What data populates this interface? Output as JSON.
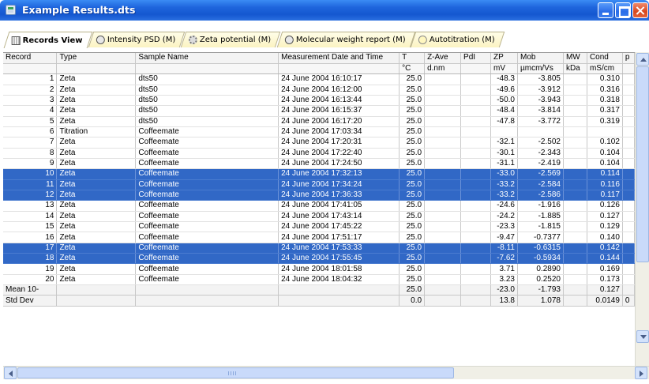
{
  "window": {
    "title": "Example Results.dts"
  },
  "tabs": [
    {
      "label": "Records View",
      "icon": "grid-icon",
      "active": true
    },
    {
      "label": "Intensity PSD (M)",
      "icon": "psd-icon",
      "active": false
    },
    {
      "label": "Zeta potential (M)",
      "icon": "zeta-icon",
      "active": false
    },
    {
      "label": "Molecular weight report (M)",
      "icon": "molecule-icon",
      "active": false
    },
    {
      "label": "Autotitration (M)",
      "icon": "titration-icon",
      "active": false
    }
  ],
  "table": {
    "columns": [
      "Record",
      "Type",
      "Sample Name",
      "Measurement Date and Time",
      "T",
      "Z-Ave",
      "PdI",
      "ZP",
      "Mob",
      "MW",
      "Cond",
      "p"
    ],
    "units": [
      "",
      "",
      "",
      "",
      "°C",
      "d.nm",
      "",
      "mV",
      "µmcm/Vs",
      "kDa",
      "mS/cm",
      ""
    ],
    "rows": [
      {
        "cells": [
          "1",
          "Zeta",
          "dts50",
          "24 June 2004 16:10:17",
          "25.0",
          "",
          "",
          "-48.3",
          "-3.805",
          "",
          "0.310",
          ""
        ],
        "selected": false
      },
      {
        "cells": [
          "2",
          "Zeta",
          "dts50",
          "24 June 2004 16:12:00",
          "25.0",
          "",
          "",
          "-49.6",
          "-3.912",
          "",
          "0.316",
          ""
        ],
        "selected": false
      },
      {
        "cells": [
          "3",
          "Zeta",
          "dts50",
          "24 June 2004 16:13:44",
          "25.0",
          "",
          "",
          "-50.0",
          "-3.943",
          "",
          "0.318",
          ""
        ],
        "selected": false
      },
      {
        "cells": [
          "4",
          "Zeta",
          "dts50",
          "24 June 2004 16:15:37",
          "25.0",
          "",
          "",
          "-48.4",
          "-3.814",
          "",
          "0.317",
          ""
        ],
        "selected": false
      },
      {
        "cells": [
          "5",
          "Zeta",
          "dts50",
          "24 June 2004 16:17:20",
          "25.0",
          "",
          "",
          "-47.8",
          "-3.772",
          "",
          "0.319",
          ""
        ],
        "selected": false
      },
      {
        "cells": [
          "6",
          "Titration",
          "Coffeemate",
          "24 June 2004 17:03:34",
          "25.0",
          "",
          "",
          "",
          "",
          "",
          "",
          ""
        ],
        "selected": false
      },
      {
        "cells": [
          "7",
          "Zeta",
          "Coffeemate",
          "24 June 2004 17:20:31",
          "25.0",
          "",
          "",
          "-32.1",
          "-2.502",
          "",
          "0.102",
          ""
        ],
        "selected": false
      },
      {
        "cells": [
          "8",
          "Zeta",
          "Coffeemate",
          "24 June 2004 17:22:40",
          "25.0",
          "",
          "",
          "-30.1",
          "-2.343",
          "",
          "0.104",
          ""
        ],
        "selected": false
      },
      {
        "cells": [
          "9",
          "Zeta",
          "Coffeemate",
          "24 June 2004 17:24:50",
          "25.0",
          "",
          "",
          "-31.1",
          "-2.419",
          "",
          "0.104",
          ""
        ],
        "selected": false
      },
      {
        "cells": [
          "10",
          "Zeta",
          "Coffeemate",
          "24 June 2004 17:32:13",
          "25.0",
          "",
          "",
          "-33.0",
          "-2.569",
          "",
          "0.114",
          ""
        ],
        "selected": true
      },
      {
        "cells": [
          "11",
          "Zeta",
          "Coffeemate",
          "24 June 2004 17:34:24",
          "25.0",
          "",
          "",
          "-33.2",
          "-2.584",
          "",
          "0.116",
          ""
        ],
        "selected": true
      },
      {
        "cells": [
          "12",
          "Zeta",
          "Coffeemate",
          "24 June 2004 17:36:33",
          "25.0",
          "",
          "",
          "-33.2",
          "-2.586",
          "",
          "0.117",
          ""
        ],
        "selected": true
      },
      {
        "cells": [
          "13",
          "Zeta",
          "Coffeemate",
          "24 June 2004 17:41:05",
          "25.0",
          "",
          "",
          "-24.6",
          "-1.916",
          "",
          "0.126",
          ""
        ],
        "selected": false
      },
      {
        "cells": [
          "14",
          "Zeta",
          "Coffeemate",
          "24 June 2004 17:43:14",
          "25.0",
          "",
          "",
          "-24.2",
          "-1.885",
          "",
          "0.127",
          ""
        ],
        "selected": false
      },
      {
        "cells": [
          "15",
          "Zeta",
          "Coffeemate",
          "24 June 2004 17:45:22",
          "25.0",
          "",
          "",
          "-23.3",
          "-1.815",
          "",
          "0.129",
          ""
        ],
        "selected": false
      },
      {
        "cells": [
          "16",
          "Zeta",
          "Coffeemate",
          "24 June 2004 17:51:17",
          "25.0",
          "",
          "",
          "-9.47",
          "-0.7377",
          "",
          "0.140",
          ""
        ],
        "selected": false
      },
      {
        "cells": [
          "17",
          "Zeta",
          "Coffeemate",
          "24 June 2004 17:53:33",
          "25.0",
          "",
          "",
          "-8.11",
          "-0.6315",
          "",
          "0.142",
          ""
        ],
        "selected": true
      },
      {
        "cells": [
          "18",
          "Zeta",
          "Coffeemate",
          "24 June 2004 17:55:45",
          "25.0",
          "",
          "",
          "-7.62",
          "-0.5934",
          "",
          "0.144",
          ""
        ],
        "selected": true
      },
      {
        "cells": [
          "19",
          "Zeta",
          "Coffeemate",
          "24 June 2004 18:01:58",
          "25.0",
          "",
          "",
          "3.71",
          "0.2890",
          "",
          "0.169",
          ""
        ],
        "selected": false
      },
      {
        "cells": [
          "20",
          "Zeta",
          "Coffeemate",
          "24 June 2004 18:04:32",
          "25.0",
          "",
          "",
          "3.23",
          "0.2520",
          "",
          "0.173",
          ""
        ],
        "selected": false
      }
    ],
    "summary": [
      {
        "cells": [
          "Mean 10-",
          "",
          "",
          "",
          "25.0",
          "",
          "",
          "-23.0",
          "-1.793",
          "",
          "0.127",
          ""
        ]
      },
      {
        "cells": [
          "Std Dev",
          "",
          "",
          "",
          "0.0",
          "",
          "",
          "13.8",
          "1.078",
          "",
          "0.0149",
          "0"
        ]
      }
    ]
  },
  "colors": {
    "selection": "#3168c6",
    "titlebar": "#1f66dd",
    "tab": "#fbf3c2"
  }
}
